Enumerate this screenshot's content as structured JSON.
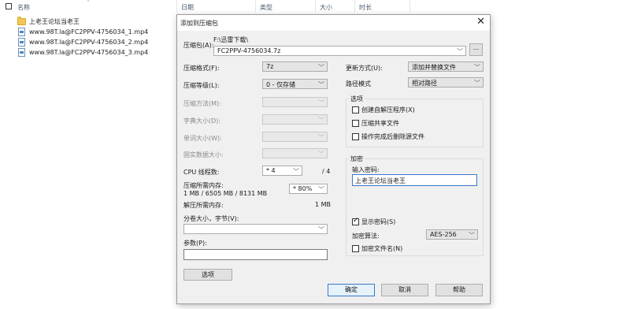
{
  "explorer": {
    "columns": {
      "name": "名称",
      "date": "日期",
      "type": "类型",
      "size": "大小",
      "duration": "时长"
    },
    "files": [
      {
        "name": "上老王论坛当老王",
        "kind": "folder"
      },
      {
        "name": "www.98T.la@FC2PPV-4756034_1.mp4",
        "kind": "video"
      },
      {
        "name": "www.98T.la@FC2PPV-4756034_2.mp4",
        "kind": "video"
      },
      {
        "name": "www.98T.la@FC2PPV-4756034_3.mp4",
        "kind": "video"
      }
    ]
  },
  "dialog": {
    "title": "添加到压缩包",
    "archive_label": "压缩包(A):",
    "archive_path_hint": "F:\\迅雷下载\\",
    "archive_name": "FC2PPV-4756034.7z",
    "browse_label": "...",
    "left": {
      "format_label": "压缩格式(F):",
      "format_value": "7z",
      "level_label": "压缩等级(L):",
      "level_value": "0 - 仅存储",
      "method_label": "压缩方法(M):",
      "dict_label": "字典大小(D):",
      "word_label": "单词大小(W):",
      "solid_label": "固实数据大小:",
      "threads_label": "CPU 线程数:",
      "threads_value": "* 4",
      "threads_total": "/ 4",
      "mem_compress_label": "压缩所需内存:",
      "mem_compress_detail": "1 MB / 6505 MB / 8131 MB",
      "mem_percent_value": "* 80%",
      "mem_decompress_label": "解压所需内存:",
      "mem_decompress_value": "1 MB",
      "split_label": "分卷大小，字节(V):",
      "split_value": "",
      "params_label": "参数(P):",
      "params_value": "",
      "options_button": "选项"
    },
    "right": {
      "update_label": "更新方式(U):",
      "update_value": "添加并替换文件",
      "path_label": "路径模式",
      "path_value": "相对路径",
      "options_group": "选项",
      "opt_sfx": "创建自解压程序(X)",
      "opt_shared": "压缩共享文件",
      "opt_delete": "操作完成后删除源文件",
      "encrypt_group": "加密",
      "password_label": "输入密码:",
      "password_value": "上老王论坛当老王",
      "show_password": "显示密码(S)",
      "enc_method_label": "加密算法:",
      "enc_method_value": "AES-256",
      "enc_filenames": "加密文件名(N)"
    },
    "buttons": {
      "ok": "确定",
      "cancel": "取消",
      "help": "帮助"
    }
  }
}
